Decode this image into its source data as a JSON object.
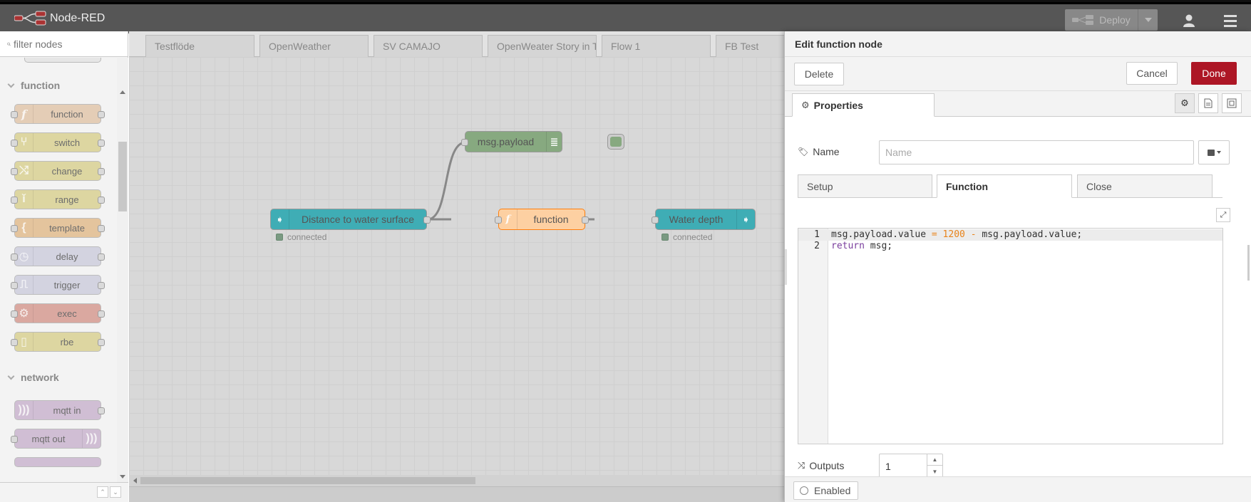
{
  "app": {
    "title": "Node-RED"
  },
  "header": {
    "deploy_label": "Deploy"
  },
  "palette": {
    "filter_placeholder": "filter nodes",
    "categories": [
      {
        "label": "function",
        "nodes": [
          "function",
          "switch",
          "change",
          "range",
          "template",
          "delay",
          "trigger",
          "exec",
          "rbe"
        ]
      },
      {
        "label": "network",
        "nodes": [
          "mqtt in",
          "mqtt out"
        ]
      }
    ]
  },
  "workspace": {
    "tabs": [
      "Testflöde",
      "OpenWeather",
      "SV CAMAJO",
      "OpenWeater Story in T",
      "Flow 1",
      "FB Test"
    ],
    "nodes": {
      "debug": "msg.payload",
      "input": "Distance to water surface",
      "function": "function",
      "output": "Water depth"
    },
    "status": {
      "input": "connected",
      "output": "connected"
    }
  },
  "editor": {
    "title": "Edit function node",
    "delete_label": "Delete",
    "cancel_label": "Cancel",
    "done_label": "Done",
    "properties_tab": "Properties",
    "name_label": "Name",
    "name_placeholder": "Name",
    "name_value": "",
    "sub_tabs": [
      "Setup",
      "Function",
      "Close"
    ],
    "code": {
      "line1_a": "msg.payload.value",
      "line1_op1": "=",
      "line1_num": "1200",
      "line1_op2": "-",
      "line1_b": "msg.payload.value;",
      "line2_kw": "return",
      "line2_rest": " msg;",
      "line_numbers": [
        "1",
        "2"
      ]
    },
    "outputs_label": "Outputs",
    "outputs_value": "1",
    "enabled_label": "Enabled"
  },
  "colors": {
    "header": "#565656",
    "done": "#ad1625",
    "function_node": "#fdd0a2",
    "inject_node": "#3fadb5",
    "debug_node": "#87a980"
  }
}
